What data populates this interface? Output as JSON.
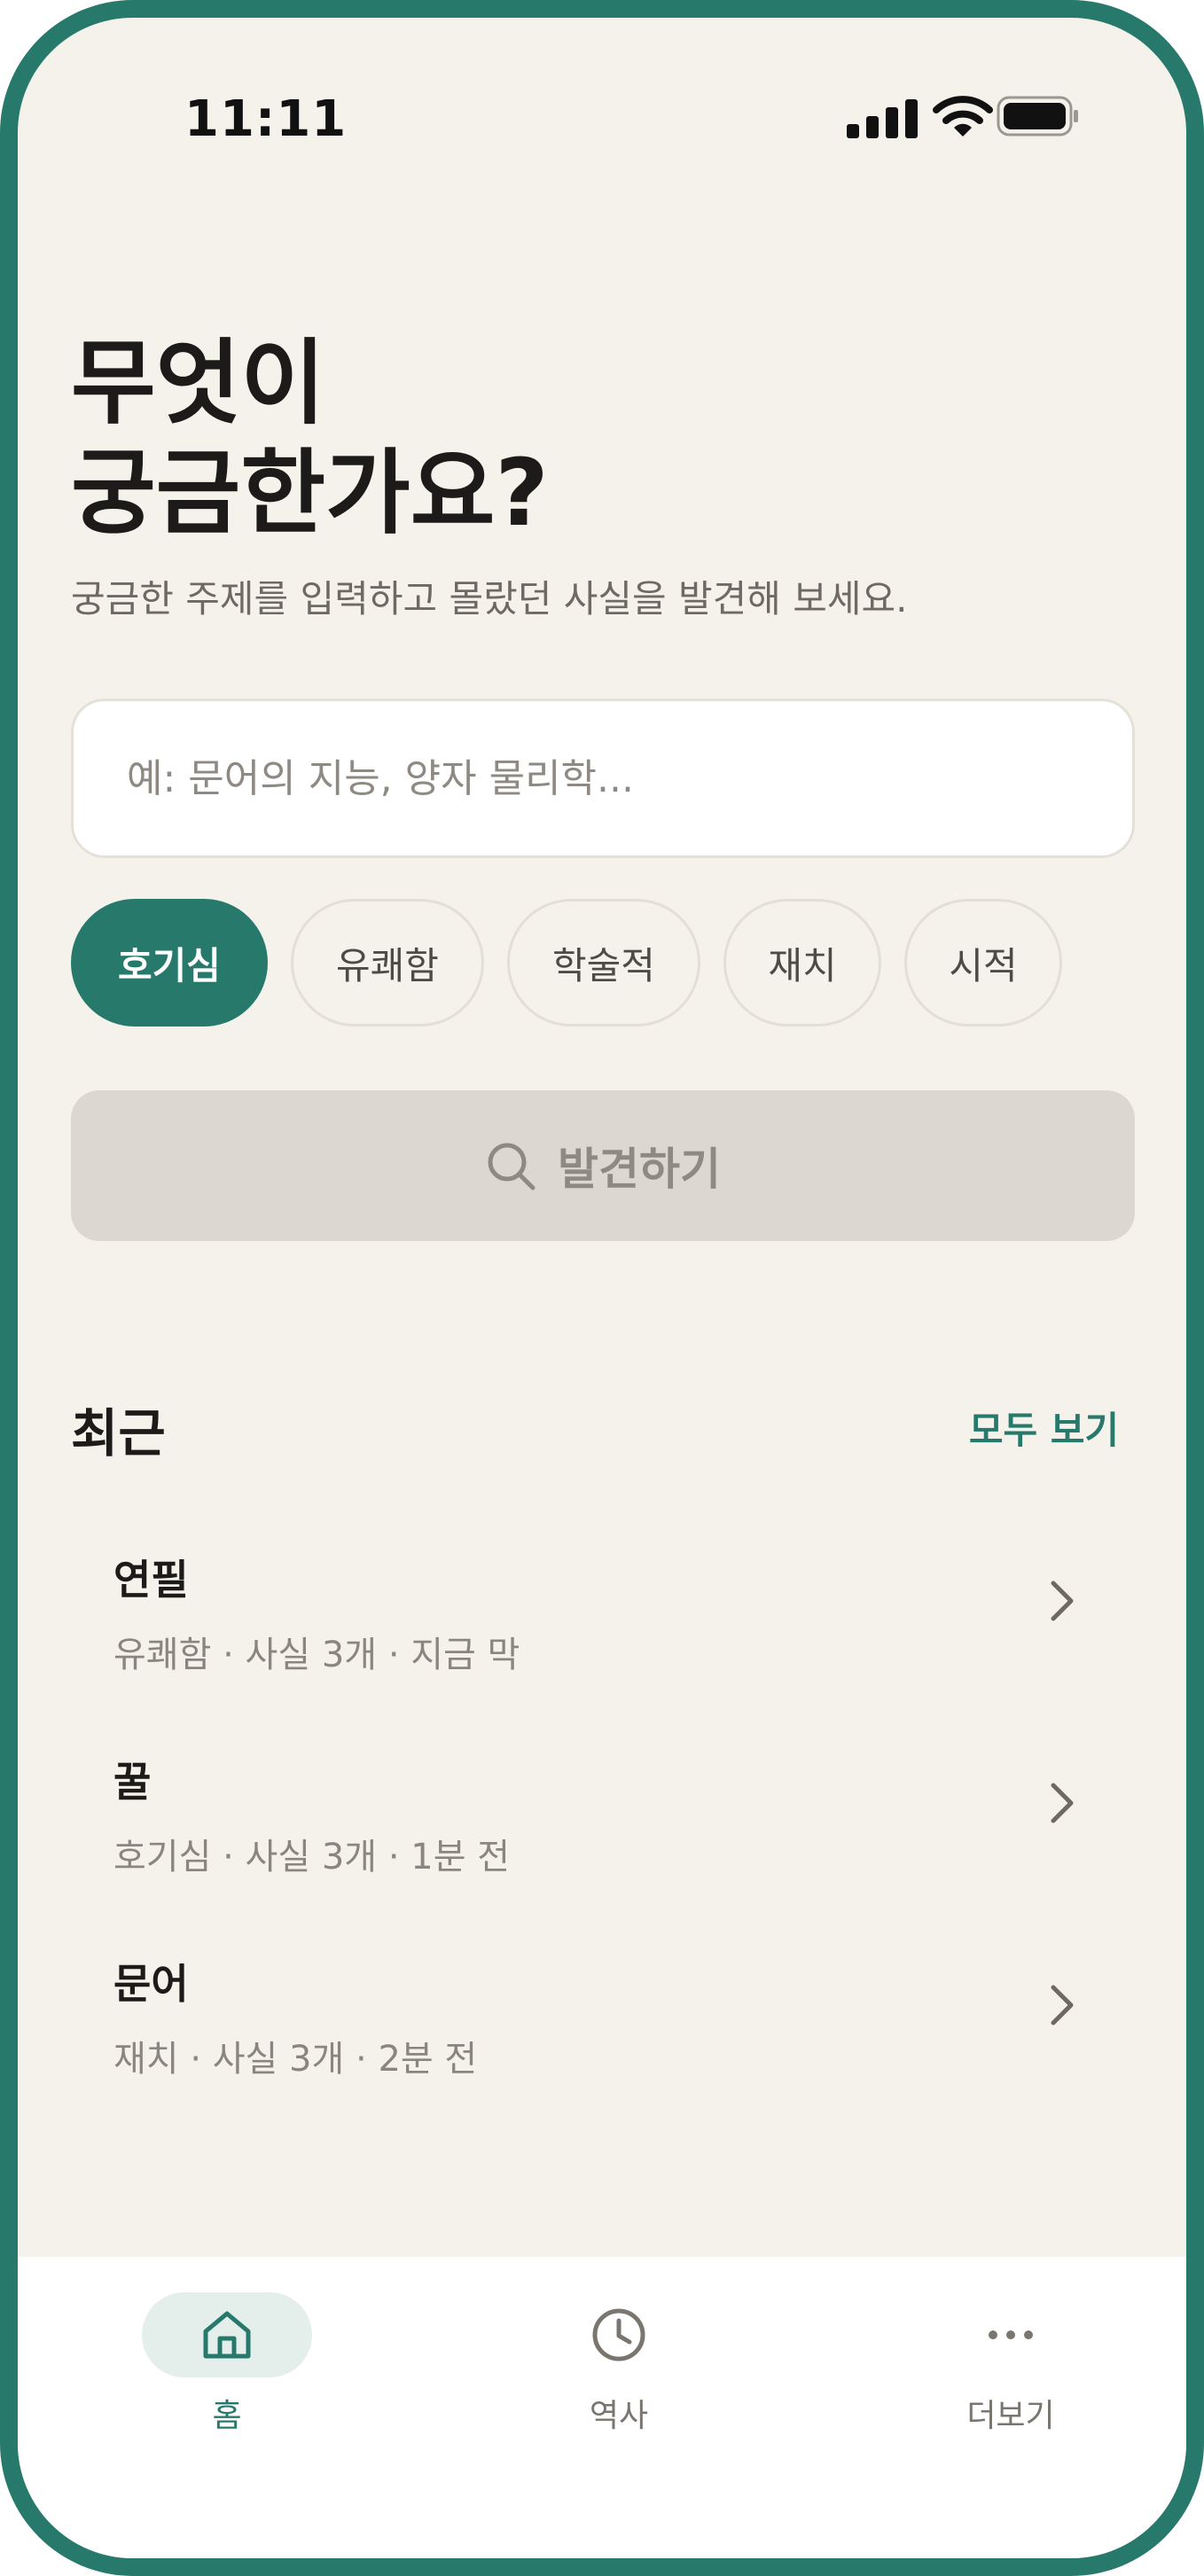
{
  "status_bar": {
    "time": "11:11"
  },
  "header": {
    "title_line1": "무엇이",
    "title_line2": "궁금한가요?",
    "subtitle": "궁금한 주제를 입력하고 몰랐던 사실을 발견해 보세요."
  },
  "search": {
    "placeholder": "예: 문어의 지능, 양자 물리학...",
    "value": ""
  },
  "tones": [
    {
      "label": "호기심",
      "selected": true
    },
    {
      "label": "유쾌함",
      "selected": false
    },
    {
      "label": "학술적",
      "selected": false
    },
    {
      "label": "재치",
      "selected": false
    },
    {
      "label": "시적",
      "selected": false
    }
  ],
  "discover_button": {
    "label": "발견하기",
    "icon": "search-icon"
  },
  "recent": {
    "title": "최근",
    "see_all": "모두 보기",
    "items": [
      {
        "title": "연필",
        "meta": "유쾌함 · 사실 3개 · 지금 막"
      },
      {
        "title": "꿀",
        "meta": "호기심 · 사실 3개 · 1분 전"
      },
      {
        "title": "문어",
        "meta": "재치 · 사실 3개 · 2분 전"
      }
    ]
  },
  "tabbar": {
    "items": [
      {
        "label": "홈",
        "icon": "home-icon",
        "active": true
      },
      {
        "label": "역사",
        "icon": "clock-icon",
        "active": false
      },
      {
        "label": "더보기",
        "icon": "more-icon",
        "active": false
      }
    ]
  },
  "colors": {
    "accent": "#26796b",
    "background": "#f5f2ec",
    "disabled_button": "#dcd8d1"
  }
}
